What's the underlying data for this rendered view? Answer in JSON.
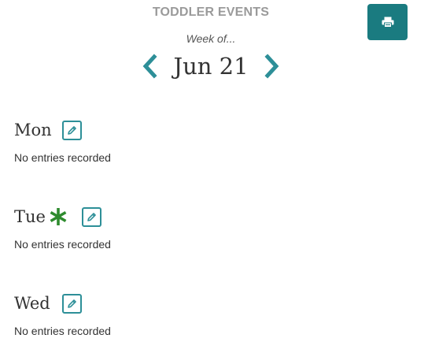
{
  "header": {
    "title": "TODDLER EVENTS",
    "week_of_label": "Week of...",
    "week_label": "Jun 21"
  },
  "icons": {
    "prev": "chevron-left-icon",
    "next": "chevron-right-icon",
    "print": "print-icon",
    "edit": "pencil-icon",
    "flag": "asterisk-icon"
  },
  "colors": {
    "accent": "#2d8f98",
    "print_button": "#1a7b80",
    "asterisk": "#2e8b2e",
    "title_gray": "#9a9a9a"
  },
  "days": [
    {
      "name": "Mon",
      "flagged": false,
      "entries_text": "No entries recorded"
    },
    {
      "name": "Tue",
      "flagged": true,
      "entries_text": "No entries recorded"
    },
    {
      "name": "Wed",
      "flagged": false,
      "entries_text": "No entries recorded"
    }
  ]
}
